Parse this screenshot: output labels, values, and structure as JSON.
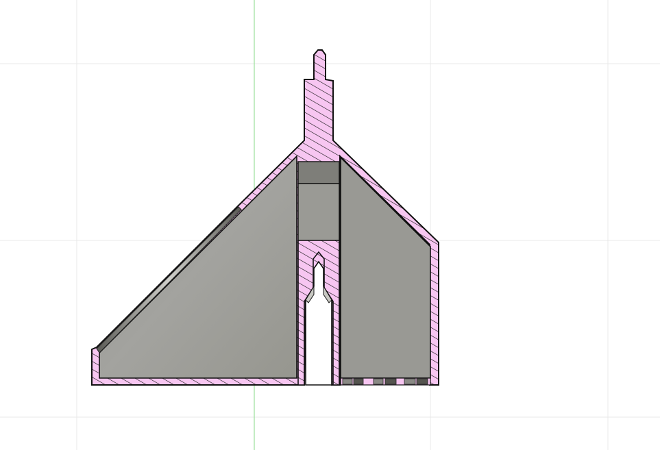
{
  "viewport": {
    "background": "#ffffff",
    "grid_color": "#e6e6e6",
    "vertical_axis_color": "#9be09b",
    "section_fill": "#f7c6f1",
    "section_hatch": "#1a1a1a",
    "body_fill": "#9b9b97",
    "outline_color": "#111111"
  }
}
